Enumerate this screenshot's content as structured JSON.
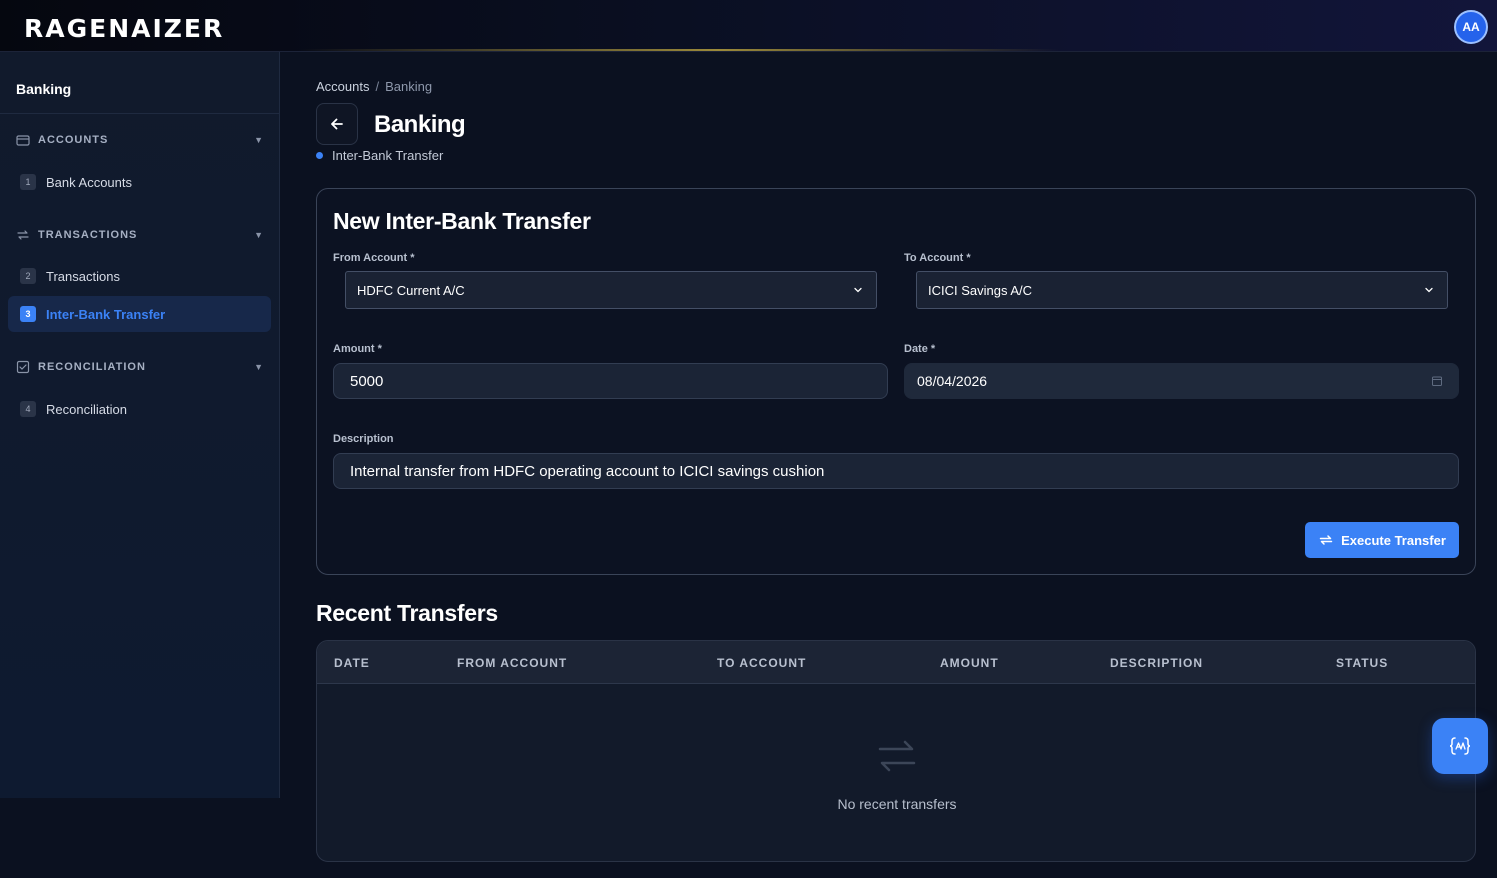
{
  "app": {
    "logo": "RAGENAIZER",
    "avatar_initials": "AA"
  },
  "sidebar": {
    "title": "Banking",
    "sections": [
      {
        "label": "ACCOUNTS",
        "icon": "credit-card-icon",
        "items": [
          {
            "num": "1",
            "label": "Bank Accounts"
          }
        ]
      },
      {
        "label": "TRANSACTIONS",
        "icon": "arrows-swap-icon",
        "items": [
          {
            "num": "2",
            "label": "Transactions"
          },
          {
            "num": "3",
            "label": "Inter-Bank Transfer",
            "active": true
          }
        ]
      },
      {
        "label": "RECONCILIATION",
        "icon": "checkbox-icon",
        "items": [
          {
            "num": "4",
            "label": "Reconciliation"
          }
        ]
      }
    ]
  },
  "breadcrumb": {
    "parent": "Accounts",
    "separator": "/",
    "current": "Banking"
  },
  "page": {
    "title": "Banking",
    "subtitle": "Inter-Bank Transfer"
  },
  "form": {
    "title": "New Inter-Bank Transfer",
    "from_account": {
      "label": "From Account *",
      "value": "HDFC Current A/C"
    },
    "to_account": {
      "label": "To Account *",
      "value": "ICICI Savings A/C"
    },
    "amount": {
      "label": "Amount *",
      "value": "5000"
    },
    "date": {
      "label": "Date *",
      "value": "08/04/2026"
    },
    "description": {
      "label": "Description",
      "value": "Internal transfer from HDFC operating account to ICICI savings cushion"
    },
    "submit_label": "Execute Transfer"
  },
  "recent": {
    "title": "Recent Transfers",
    "columns": [
      "DATE",
      "FROM ACCOUNT",
      "TO ACCOUNT",
      "AMOUNT",
      "DESCRIPTION",
      "STATUS"
    ],
    "empty_text": "No recent transfers"
  },
  "colors": {
    "accent": "#3b82f6",
    "background": "#0b1120",
    "sidebar": "#111a2c"
  }
}
